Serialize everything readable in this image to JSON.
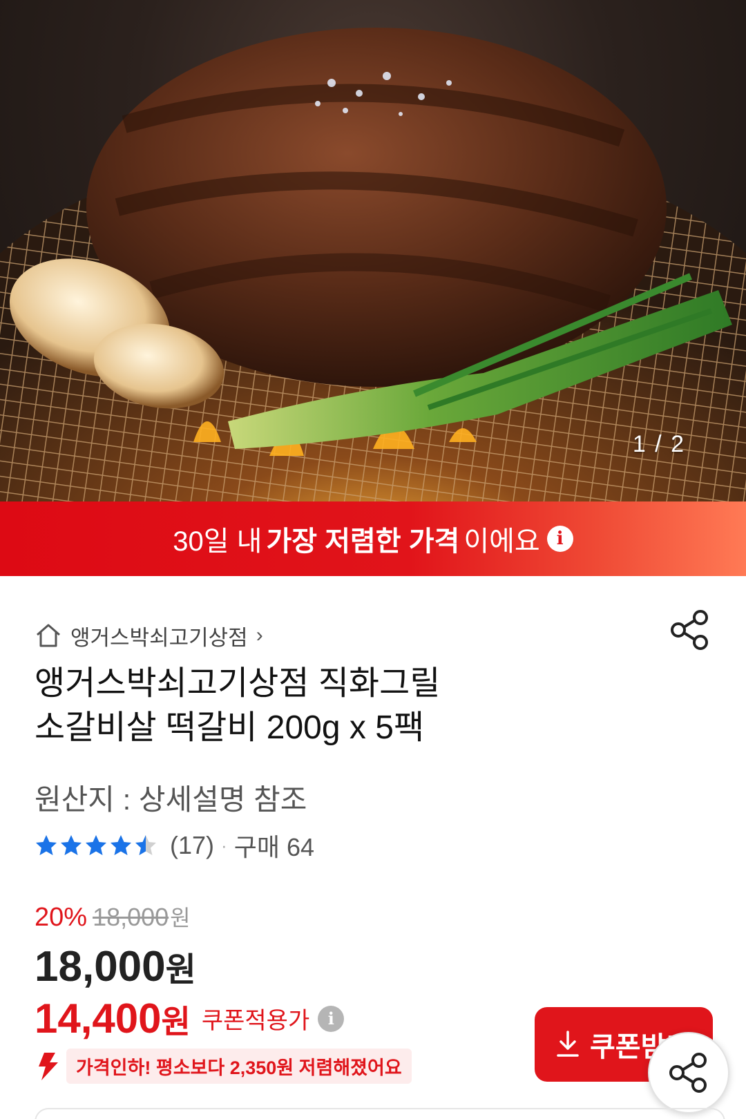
{
  "hero": {
    "image_label": "grilled tteokgalbi patty with garlic and green onion",
    "counter": "1 / 2"
  },
  "promo": {
    "prefix": "30일 내",
    "bold": "가장 저렴한 가격",
    "suffix": "이에요",
    "info_icon": "i"
  },
  "shop": {
    "name": "앵거스박쇠고기상점",
    "chevron": "›"
  },
  "product": {
    "title_line1": "앵거스박쇠고기상점 직화그릴",
    "title_line2": "소갈비살 떡갈비 200g x 5팩",
    "origin": "원산지 : 상세설명 참조"
  },
  "rating": {
    "stars": 4.5,
    "review_count": "(17)",
    "separator": "·",
    "sold": "구매 64",
    "colors": {
      "filled": "#1a73e8",
      "empty": "#d0d0d0"
    }
  },
  "price": {
    "discount": "20%",
    "original": "18,000",
    "original_unit": "원",
    "current": "18,000",
    "current_unit": "원",
    "coupon": "14,400",
    "coupon_unit": "원",
    "coupon_label": "쿠폰적용가",
    "coupon_info_icon": "i",
    "drop_notice": "가격인하! 평소보다 2,350원 저렴해졌어요"
  },
  "buttons": {
    "coupon_download": "쿠폰받기"
  },
  "colors": {
    "accent": "#e0151b",
    "promo_gradient_end": "#ff7a55"
  }
}
